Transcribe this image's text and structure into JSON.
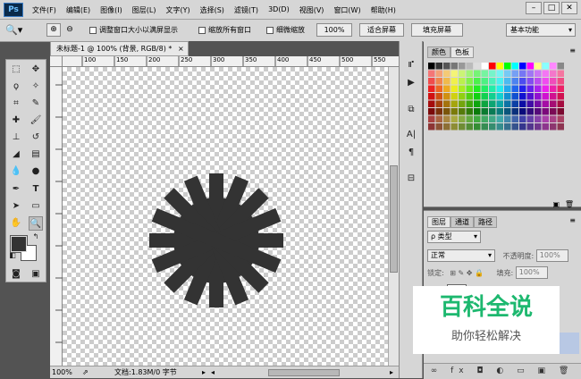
{
  "app": {
    "logo": "Ps"
  },
  "menu": [
    "文件(F)",
    "编辑(E)",
    "图像(I)",
    "图层(L)",
    "文字(Y)",
    "选择(S)",
    "滤镜(T)",
    "3D(D)",
    "视图(V)",
    "窗口(W)",
    "帮助(H)"
  ],
  "window_controls": [
    "–",
    "□",
    "✕"
  ],
  "options": {
    "resize_windows": "调整窗口大小以满屏显示",
    "zoom_all": "缩放所有窗口",
    "scrubby_zoom": "细微缩放",
    "zoom_100": "100%",
    "fit_screen": "适合屏幕",
    "fill_screen": "填充屏幕",
    "workspace": "基本功能"
  },
  "document": {
    "tab_title": "未标题-1 @ 100% (背景, RGB/8) *",
    "tab_close": "×",
    "ruler_ticks": [
      "100",
      "150",
      "200",
      "250",
      "300",
      "350",
      "400",
      "450",
      "500",
      "550"
    ],
    "zoom": "100%",
    "status": "文档:1.83M/0 字节"
  },
  "swatches_panel": {
    "tabs": [
      "颜色",
      "色板"
    ]
  },
  "layers_panel": {
    "tabs": [
      "图层",
      "通道",
      "路径"
    ],
    "filter": "ρ 类型",
    "blend_mode": "正常",
    "opacity_label": "不透明度:",
    "opacity_value": "100%",
    "lock_label": "锁定:",
    "fill_label": "填充:",
    "fill_value": "100%",
    "footer_icons": "∞ fx ◘ ◐ ▭ ▣ 🗑"
  },
  "watermark": {
    "title": "百科全说",
    "subtitle": "助你轻松解决"
  },
  "colors": {
    "accent": "#1db86f",
    "shape": "#333333"
  }
}
